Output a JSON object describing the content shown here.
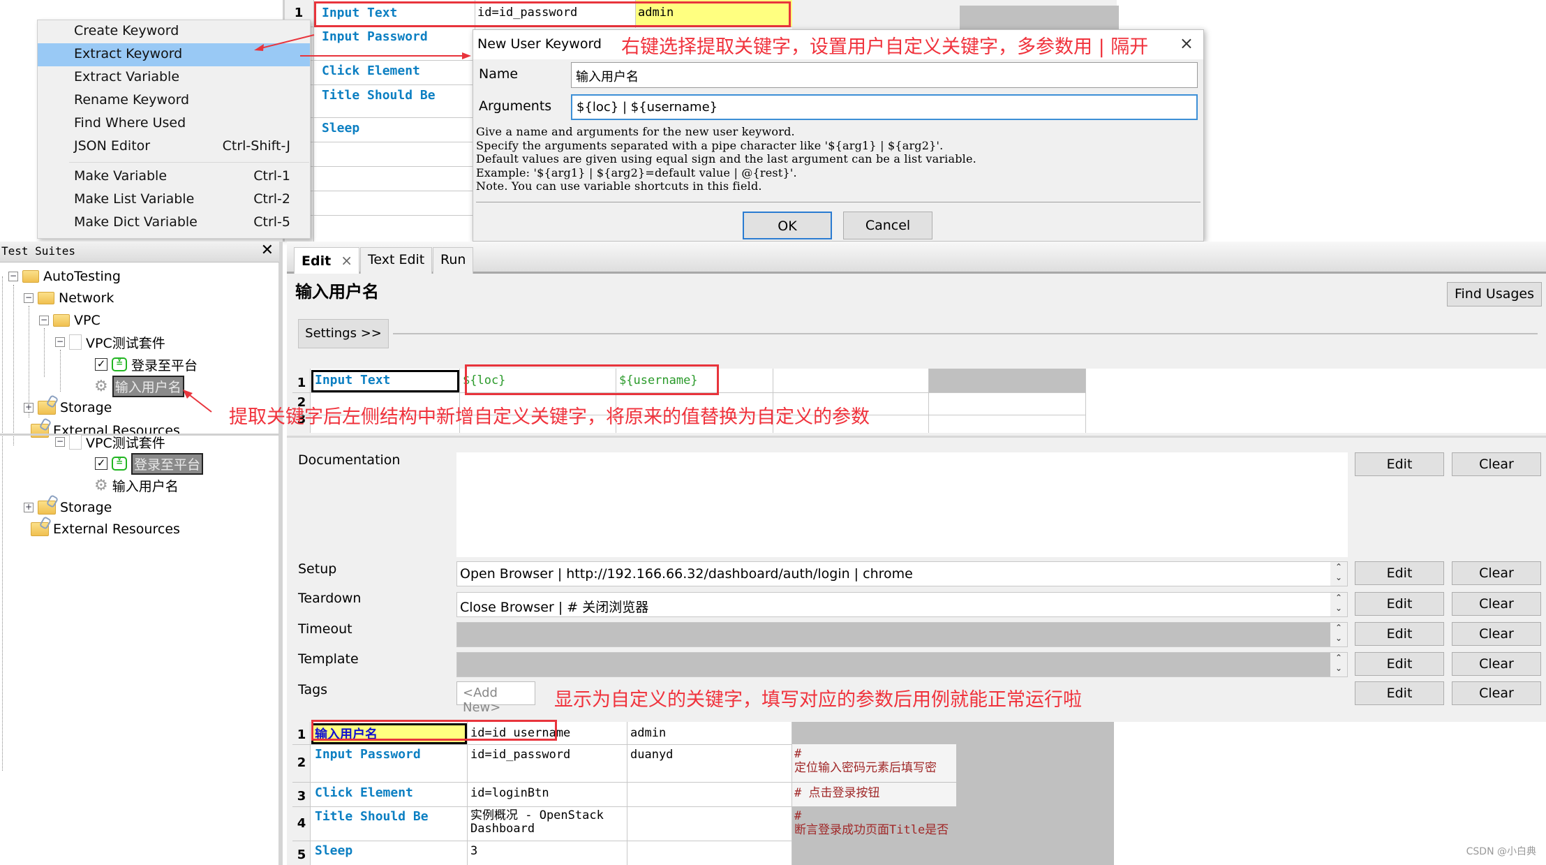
{
  "context_menu": {
    "items": [
      {
        "label": "Create Keyword",
        "shortcut": ""
      },
      {
        "label": "Extract Keyword",
        "shortcut": "",
        "highlighted": true
      },
      {
        "label": "Extract Variable",
        "shortcut": ""
      },
      {
        "label": "Rename Keyword",
        "shortcut": ""
      },
      {
        "label": "Find Where Used",
        "shortcut": ""
      },
      {
        "label": "JSON Editor",
        "shortcut": "Ctrl-Shift-J"
      },
      {
        "label": "Make Variable",
        "shortcut": "Ctrl-1"
      },
      {
        "label": "Make List Variable",
        "shortcut": "Ctrl-2"
      },
      {
        "label": "Make Dict Variable",
        "shortcut": "Ctrl-5"
      }
    ]
  },
  "top_table": {
    "rows": [
      {
        "num": "1",
        "keyword": "Input Text",
        "arg1": "id=id_password",
        "arg2": "admin"
      },
      {
        "num": "",
        "keyword": "Input Password",
        "arg1": "",
        "arg2": ""
      },
      {
        "num": "",
        "keyword": "Click Element",
        "arg1": "",
        "arg2": ""
      },
      {
        "num": "",
        "keyword": "Title Should Be",
        "arg1": "",
        "arg2": ""
      },
      {
        "num": "",
        "keyword": "Sleep",
        "arg1": "",
        "arg2": ""
      }
    ]
  },
  "dialog": {
    "title": "New User Keyword",
    "name_label": "Name",
    "name_value": "输入用户名",
    "arguments_label": "Arguments",
    "arguments_value": "${loc} | ${username}",
    "help_text": "Give a name and arguments for the new user keyword.\nSpecify the arguments separated with a pipe character like '${arg1} | ${arg2}'.\nDefault values are given using equal sign and the last argument can be a list variable.\nExample: '${arg1} | ${arg2}=default value | @{rest}'.\nNote. You can use variable shortcuts in this field.",
    "ok_label": "OK",
    "cancel_label": "Cancel",
    "close_icon": "×"
  },
  "annotations": {
    "dialog_note": "右键选择提取关键字，设置用户自定义关键字，多参数用 | 隔开",
    "tree_note": "提取关键字后左侧结构中新增自定义关键字，将原来的值替换为自定义的参数",
    "bottom_note": "显示为自定义的关键字，填写对应的参数后用例就能正常运行啦"
  },
  "tree": {
    "header": "Test Suites",
    "close_icon": "✕",
    "nodes_upper": [
      {
        "label": "AutoTesting"
      },
      {
        "label": "Network"
      },
      {
        "label": "VPC"
      },
      {
        "label": "VPC测试套件"
      },
      {
        "label": "登录至平台"
      },
      {
        "label": "输入用户名"
      },
      {
        "label": "Storage"
      },
      {
        "label": "External Resources"
      }
    ],
    "nodes_lower": [
      {
        "label": "VPC测试套件"
      },
      {
        "label": "登录至平台"
      },
      {
        "label": "输入用户名"
      },
      {
        "label": "Storage"
      },
      {
        "label": "External Resources"
      }
    ]
  },
  "tabs": [
    {
      "label": "Edit",
      "active": true
    },
    {
      "label": "Text Edit",
      "active": false
    },
    {
      "label": "Run",
      "active": false
    }
  ],
  "editor": {
    "keyword_title": "输入用户名",
    "find_usages_label": "Find Usages",
    "settings_label": "Settings >>",
    "mid_table": {
      "rows": [
        {
          "num": "1",
          "keyword": "Input Text",
          "arg1": "${loc}",
          "arg2": "${username}"
        },
        {
          "num": "2",
          "keyword": "",
          "arg1": "",
          "arg2": ""
        },
        {
          "num": "3",
          "keyword": "",
          "arg1": "",
          "arg2": ""
        }
      ]
    },
    "properties": [
      {
        "label": "Documentation",
        "value": "",
        "disabled": false
      },
      {
        "label": "Setup",
        "value": "Open Browser | http://192.166.66.32/dashboard/auth/login | chrome",
        "disabled": false
      },
      {
        "label": "Teardown",
        "value": "Close Browser | # 关闭浏览器",
        "disabled": false
      },
      {
        "label": "Timeout",
        "value": "",
        "disabled": true
      },
      {
        "label": "Template",
        "value": "",
        "disabled": true
      },
      {
        "label": "Tags",
        "value": "<Add New>",
        "disabled": false
      }
    ],
    "edit_label": "Edit",
    "clear_label": "Clear"
  },
  "bottom_table": {
    "rows": [
      {
        "num": "1",
        "keyword": "输入用户名",
        "arg1": "id=id_username",
        "arg2": "admin",
        "comment": ""
      },
      {
        "num": "2",
        "keyword": "Input Password",
        "arg1": "id=id_password",
        "arg2": "duanyd",
        "comment": "#\n定位输入密码元素后填写密"
      },
      {
        "num": "3",
        "keyword": "Click Element",
        "arg1": "id=loginBtn",
        "arg2": "",
        "comment": "# 点击登录按钮"
      },
      {
        "num": "4",
        "keyword": "Title Should Be",
        "arg1": "实例概况 - OpenStack\nDashboard",
        "arg2": "",
        "comment": "#\n断言登录成功页面Title是否"
      },
      {
        "num": "5",
        "keyword": "Sleep",
        "arg1": "3",
        "arg2": "",
        "comment": ""
      }
    ]
  },
  "watermark": "CSDN @小白典",
  "colors": {
    "keyword_blue": "#0c7fc2",
    "variable_green": "#2a9a2a",
    "annotation_red": "#f0323c",
    "highlight_yellow": "#ffff80",
    "menu_highlight": "#99c9f5",
    "comment_red": "#a02828"
  }
}
